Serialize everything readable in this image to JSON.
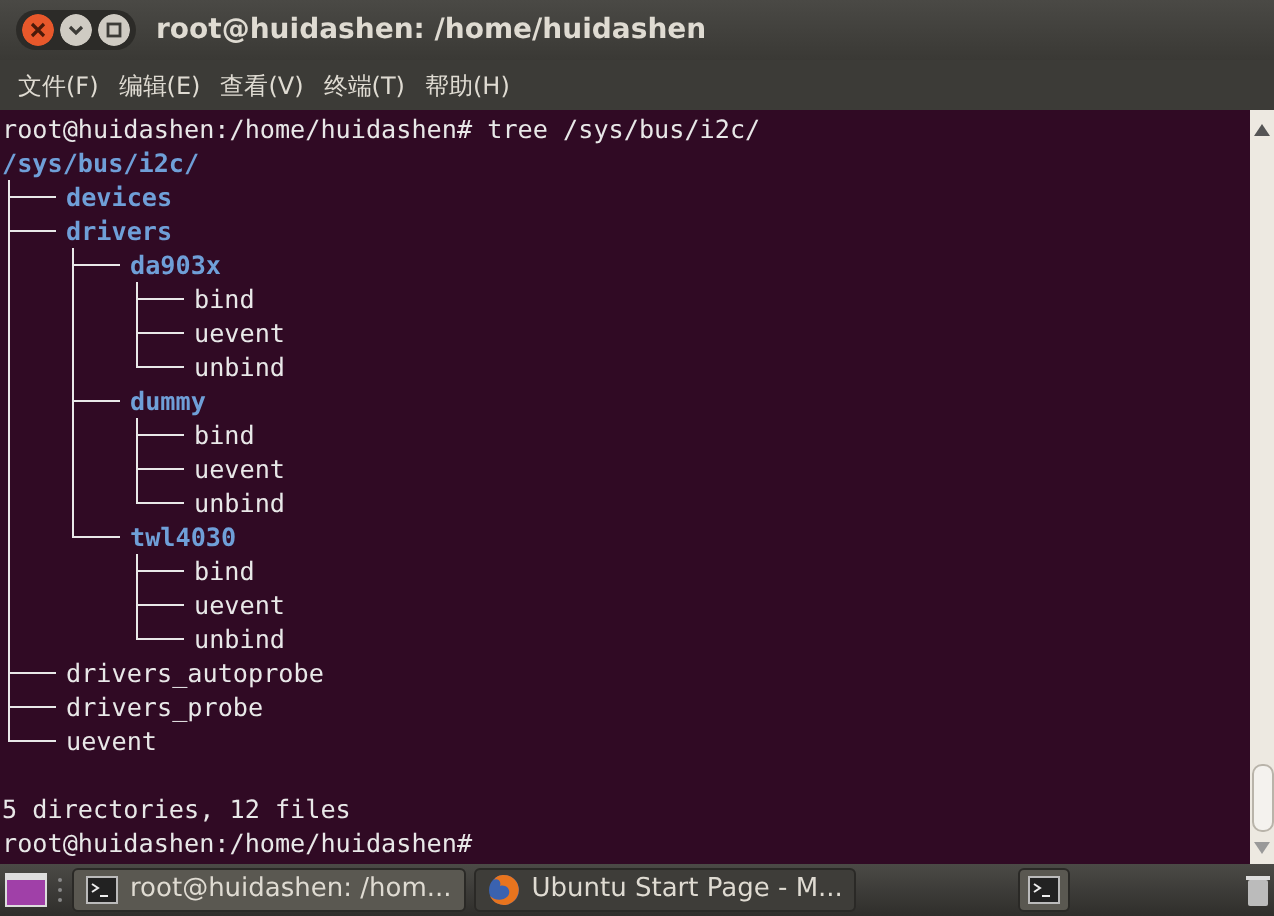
{
  "window": {
    "title": "root@huidashen: /home/huidashen"
  },
  "menu": [
    "文件(F)",
    "编辑(E)",
    "查看(V)",
    "终端(T)",
    "帮助(H)"
  ],
  "terminal": {
    "lines": [
      {
        "kind": "prompt",
        "text": "root@huidashen:/home/huidashen# tree /sys/bus/i2c/"
      },
      {
        "kind": "tree",
        "root": "/sys/bus/i2c/",
        "children": [
          {
            "name": "devices",
            "kind": "dir"
          },
          {
            "name": "drivers",
            "kind": "dir",
            "children": [
              {
                "name": "da903x",
                "kind": "dir",
                "children": [
                  {
                    "name": "bind",
                    "kind": "file"
                  },
                  {
                    "name": "uevent",
                    "kind": "file"
                  },
                  {
                    "name": "unbind",
                    "kind": "file"
                  }
                ]
              },
              {
                "name": "dummy",
                "kind": "dir",
                "children": [
                  {
                    "name": "bind",
                    "kind": "file"
                  },
                  {
                    "name": "uevent",
                    "kind": "file"
                  },
                  {
                    "name": "unbind",
                    "kind": "file"
                  }
                ]
              },
              {
                "name": "twl4030",
                "kind": "dir",
                "children": [
                  {
                    "name": "bind",
                    "kind": "file"
                  },
                  {
                    "name": "uevent",
                    "kind": "file"
                  },
                  {
                    "name": "unbind",
                    "kind": "file"
                  }
                ]
              }
            ]
          },
          {
            "name": "drivers_autoprobe",
            "kind": "file"
          },
          {
            "name": "drivers_probe",
            "kind": "file"
          },
          {
            "name": "uevent",
            "kind": "file"
          }
        ]
      },
      {
        "kind": "summary",
        "text": "5 directories, 12 files"
      },
      {
        "kind": "prompt",
        "text": "root@huidashen:/home/huidashen#"
      }
    ]
  },
  "taskbar": {
    "tasks": [
      {
        "kind": "terminal",
        "label": "root@huidashen: /hom...",
        "selected": true
      },
      {
        "kind": "browser",
        "label": "Ubuntu Start Page - M...",
        "selected": false
      }
    ]
  }
}
